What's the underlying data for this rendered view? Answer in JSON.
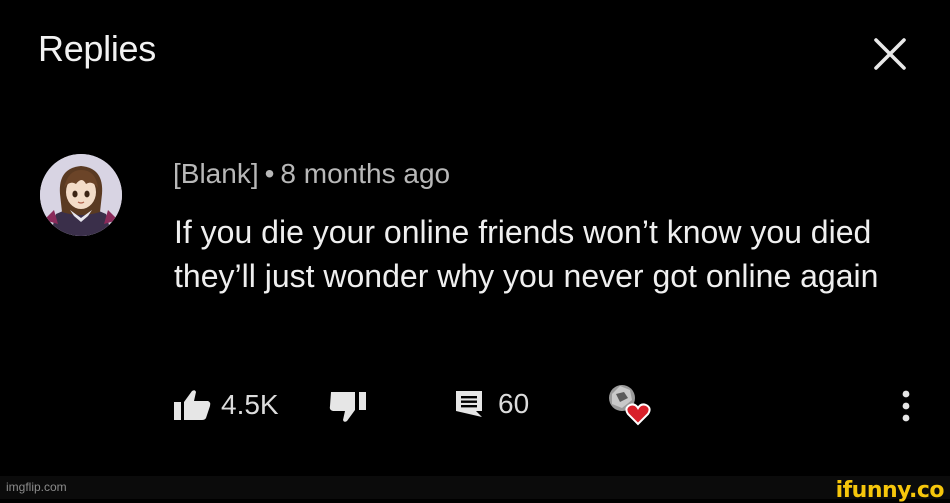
{
  "header": {
    "title": "Replies",
    "close_icon": "close-icon"
  },
  "comment": {
    "author": "[Blank]",
    "separator": "•",
    "time": "8 months ago",
    "text": "If you die your online friends won’t know you died they’ll just wonder why you never got online again",
    "avatar_icon": "anime-girl-avatar",
    "actions": {
      "like_icon": "thumbs-up-icon",
      "like_count": "4.5K",
      "dislike_icon": "thumbs-down-icon",
      "reply_icon": "comment-icon",
      "reply_count": "60",
      "creator_heart_icon": "creator-heart-icon",
      "more_icon": "more-vert-icon"
    }
  },
  "watermarks": {
    "left": "imgflip.com",
    "right": "ifunny.co"
  },
  "colors": {
    "background": "#000000",
    "text": "#efefef",
    "meta": "#b8b8b8",
    "heart": "#d8202a",
    "ifunny": "#f6c60b"
  }
}
